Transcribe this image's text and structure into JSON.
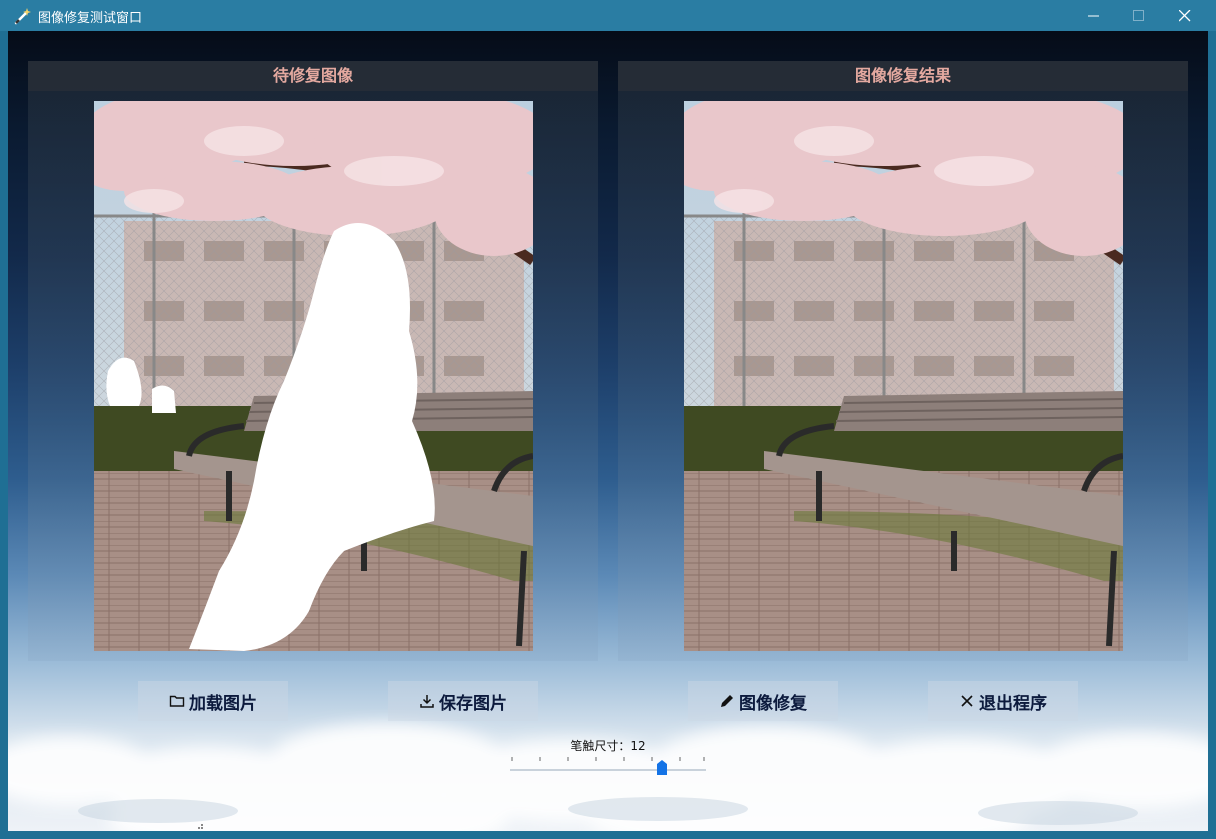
{
  "window": {
    "title": "图像修复测试窗口"
  },
  "panels": {
    "left_title": "待修复图像",
    "right_title": "图像修复结果"
  },
  "buttons": {
    "load": "加载图片",
    "save": "保存图片",
    "repair": "图像修复",
    "exit": "退出程序"
  },
  "brush": {
    "label": "笔触尺寸：12",
    "value": 12
  },
  "colors": {
    "title_bar": "#2a7da3",
    "panel_title": "#e4a9a0",
    "slider_thumb": "#1473e6"
  }
}
